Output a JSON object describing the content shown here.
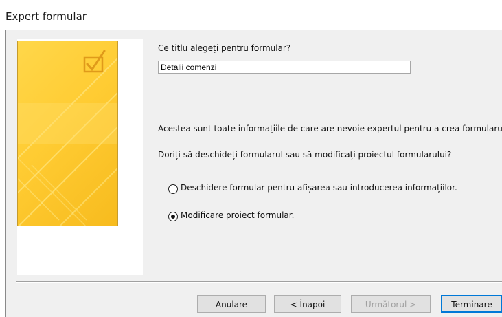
{
  "window": {
    "title": "Expert formular"
  },
  "question_title": "Ce titlu alegeți pentru formular?",
  "title_input_value": "Detalii comenzi",
  "info_text": "Acestea sunt toate informațiile de care are nevoie expertul pentru a crea formularu",
  "open_question": "Doriți să deschideți formularul sau să modificați proiectul formularului?",
  "options": [
    {
      "label": "Deschidere formular pentru afișarea sau introducerea informațiilor.",
      "selected": false
    },
    {
      "label": "Modificare proiect formular.",
      "selected": true
    }
  ],
  "buttons": {
    "cancel": "Anulare",
    "back": "< Înapoi",
    "next": "Următorul >",
    "finish": "Terminare"
  },
  "colors": {
    "art_fill": "#ffcc33",
    "art_border": "#c69b2c",
    "accent": "#0078d7"
  },
  "icons": {
    "art_checkbox": "checkbox-check-icon"
  }
}
